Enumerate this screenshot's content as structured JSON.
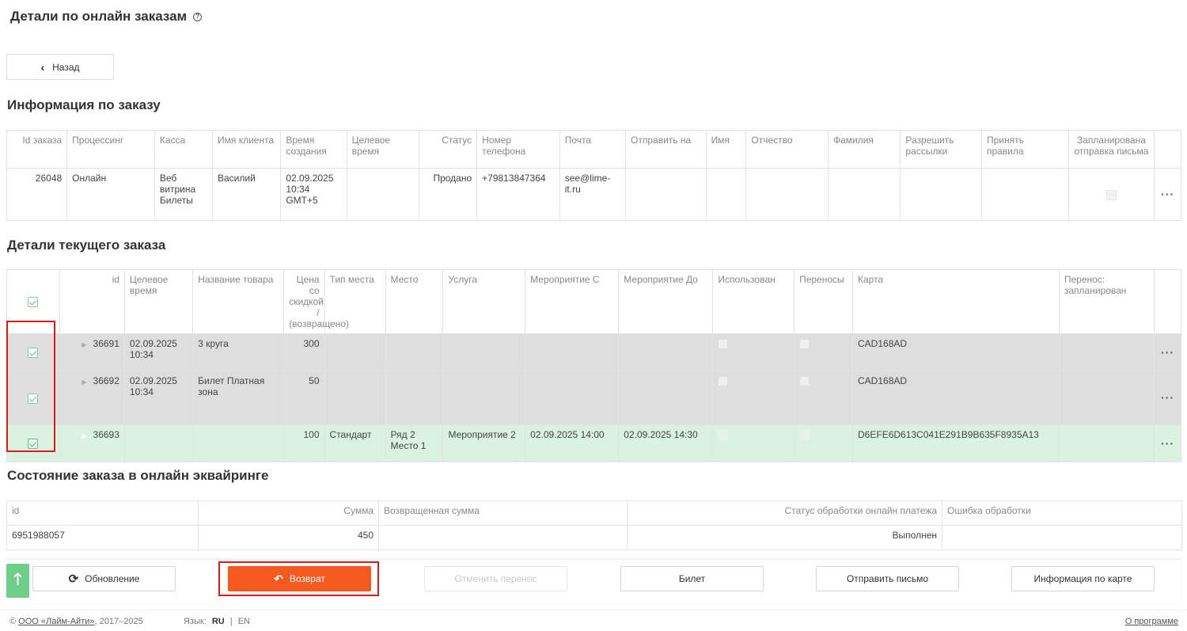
{
  "header": {
    "title": "Детали по онлайн заказам",
    "help_icon": "?"
  },
  "back_button": {
    "label": "Назад"
  },
  "order_info": {
    "title": "Информация по заказу",
    "columns": [
      "Id заказа",
      "Процессинг",
      "Касса",
      "Имя клиента",
      "Время создания",
      "Целевое время",
      "Статус",
      "Номер телефона",
      "Почта",
      "Отправить на",
      "Имя",
      "Отчество",
      "Фамилия",
      "Разрешить рассылки",
      "Принять правила",
      "Запланирована отправка письма"
    ],
    "row": {
      "id": "26048",
      "processing": "Онлайн",
      "kassa": "Веб витрина Билеты",
      "client": "Василий",
      "created": "02.09.2025 10:34 GMT+5",
      "target": "",
      "status": "Продано",
      "phone": "+79813847364",
      "email": "see@lime-it.ru",
      "send_to": "",
      "name": "",
      "patronymic": "",
      "surname": "",
      "allow_mail": "",
      "accept_rules": ""
    }
  },
  "current_order": {
    "title": "Детали текущего заказа",
    "columns": [
      "id",
      "Целевое время",
      "Название товара",
      "Цена со скидкой / (возвращено)",
      "Тип места",
      "Место",
      "Услуга",
      "Мероприятие С",
      "Мероприятие До",
      "Использован",
      "Переносы",
      "Карта",
      "Перенос: запланирован"
    ],
    "rows": [
      {
        "id": "36691",
        "time": "02.09.2025 10:34",
        "name": "3 круга",
        "price": "300",
        "seat_type": "",
        "seat": "",
        "service": "",
        "from": "",
        "to": "",
        "card": "CAD168AD"
      },
      {
        "id": "36692",
        "time": "02.09.2025 10:34",
        "name": "Билет Платная зона",
        "price": "50",
        "seat_type": "",
        "seat": "",
        "service": "",
        "from": "",
        "to": "",
        "card": "CAD168AD"
      },
      {
        "id": "36693",
        "time": "",
        "name": "",
        "price": "100",
        "seat_type": "Стандарт",
        "seat": "Ряд 2 Место 1",
        "service": "Мероприятие 2",
        "from": "02.09.2025 14:00",
        "to": "02.09.2025 14:30",
        "card": "D6EFE6D613C041E291B9B635F8935A13"
      }
    ]
  },
  "acquiring": {
    "title": "Состояние заказа в онлайн эквайринге",
    "columns": [
      "id",
      "Сумма",
      "Возвращенная сумма",
      "Статус обработки онлайн платежа",
      "Ошибка обработки"
    ],
    "row": {
      "id": "6951988057",
      "sum": "450",
      "returned": "",
      "status": "Выполнен",
      "error": ""
    }
  },
  "toolbar": {
    "refresh": "Обновление",
    "refund": "Возврат",
    "cancel_transfer": "Отменить перенос",
    "ticket": "Билет",
    "send_letter": "Отправить письмо",
    "card_info": "Информация по карте"
  },
  "footer": {
    "copyright_prefix": "©",
    "company": "ООО «Лайм-Айти»",
    "years": ", 2017–2025",
    "lang_label": "Язык:",
    "lang_ru": "RU",
    "lang_sep": "|",
    "lang_en": "EN",
    "about": "О программе"
  },
  "colors": {
    "primary": "#f45a1e",
    "selected_row": "#daf3e0",
    "grey_row": "#dedede",
    "scroll_up": "#6dcf8a",
    "highlight": "#e01818"
  }
}
